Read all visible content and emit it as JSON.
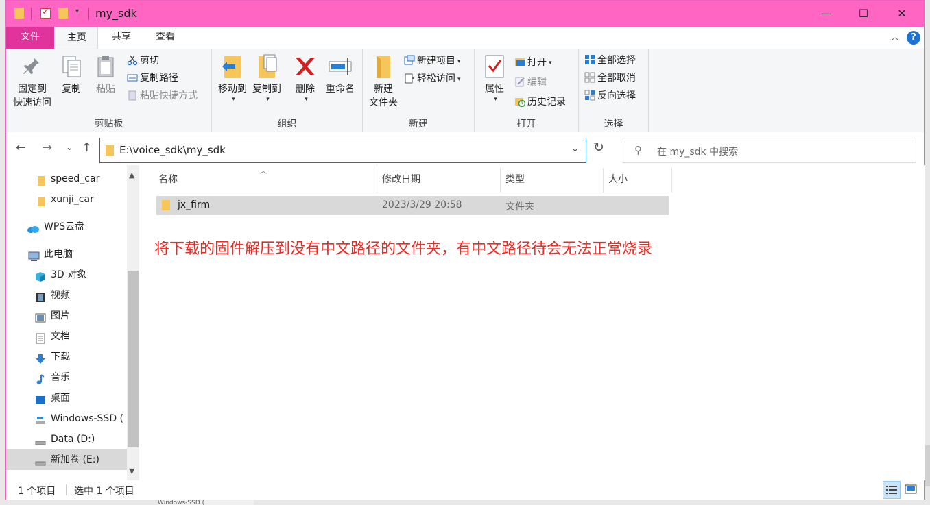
{
  "window": {
    "title": "my_sdk"
  },
  "titlebar": {
    "minimize_icon": "—",
    "maximize_icon": "☐",
    "close_icon": "✕",
    "dropdown_icon": "▾"
  },
  "ribbon_tabs": {
    "file": "文件",
    "home": "主页",
    "share": "共享",
    "view": "查看"
  },
  "ribbon": {
    "clipboard": {
      "label": "剪贴板",
      "pin_line1": "固定到",
      "pin_line2": "快速访问",
      "copy": "复制",
      "paste": "粘贴",
      "cut": "剪切",
      "copy_path": "复制路径",
      "paste_shortcut": "粘贴快捷方式"
    },
    "organize": {
      "label": "组织",
      "move_to": "移动到",
      "copy_to": "复制到",
      "delete": "删除",
      "rename": "重命名"
    },
    "new": {
      "label": "新建",
      "new_folder_line1": "新建",
      "new_folder_line2": "文件夹",
      "new_item": "新建项目",
      "easy_access": "轻松访问"
    },
    "open": {
      "label": "打开",
      "properties": "属性",
      "open": "打开",
      "edit": "编辑",
      "history": "历史记录"
    },
    "select": {
      "label": "选择",
      "select_all": "全部选择",
      "select_none": "全部取消",
      "invert": "反向选择"
    }
  },
  "navbar": {
    "back": "←",
    "forward": "→",
    "recent": "⌄",
    "up": "↑",
    "path": "E:\\voice_sdk\\my_sdk",
    "refresh": "↻",
    "search_placeholder": "在 my_sdk 中搜索"
  },
  "nav_pane": {
    "items": [
      {
        "label": "speed_car",
        "icon": "folder-icon"
      },
      {
        "label": "xunji_car",
        "icon": "folder-icon"
      },
      {
        "label": "WPS云盘",
        "icon": "cloud-icon"
      },
      {
        "label": "此电脑",
        "icon": "computer-icon"
      },
      {
        "label": "3D 对象",
        "icon": "cube-icon"
      },
      {
        "label": "视频",
        "icon": "film-icon"
      },
      {
        "label": "图片",
        "icon": "picture-icon"
      },
      {
        "label": "文档",
        "icon": "document-icon"
      },
      {
        "label": "下载",
        "icon": "download-icon"
      },
      {
        "label": "音乐",
        "icon": "music-icon"
      },
      {
        "label": "桌面",
        "icon": "desktop-icon"
      },
      {
        "label": "Windows-SSD (",
        "icon": "drive-icon"
      },
      {
        "label": "Data (D:)",
        "icon": "drive-icon"
      },
      {
        "label": "新加卷 (E:)",
        "icon": "drive-icon"
      }
    ]
  },
  "file_list": {
    "columns": {
      "name": "名称",
      "date": "修改日期",
      "type": "类型",
      "size": "大小"
    },
    "rows": [
      {
        "name": "jx_firm",
        "date": "2023/3/29 20:58",
        "type": "文件夹",
        "size": ""
      }
    ]
  },
  "annotation": "将下载的固件解压到没有中文路径的文件夹，有中文路径待会无法正常烧录",
  "status": {
    "item_count": "1 个项目",
    "selected": "选中 1 个项目"
  },
  "behind_window": {
    "text": "Windows-SSD ("
  },
  "colors": {
    "titlebar": "#ff66c4",
    "file_tab": "#e0339b",
    "annotation": "#ee2a24",
    "accent": "#0a74d6"
  }
}
